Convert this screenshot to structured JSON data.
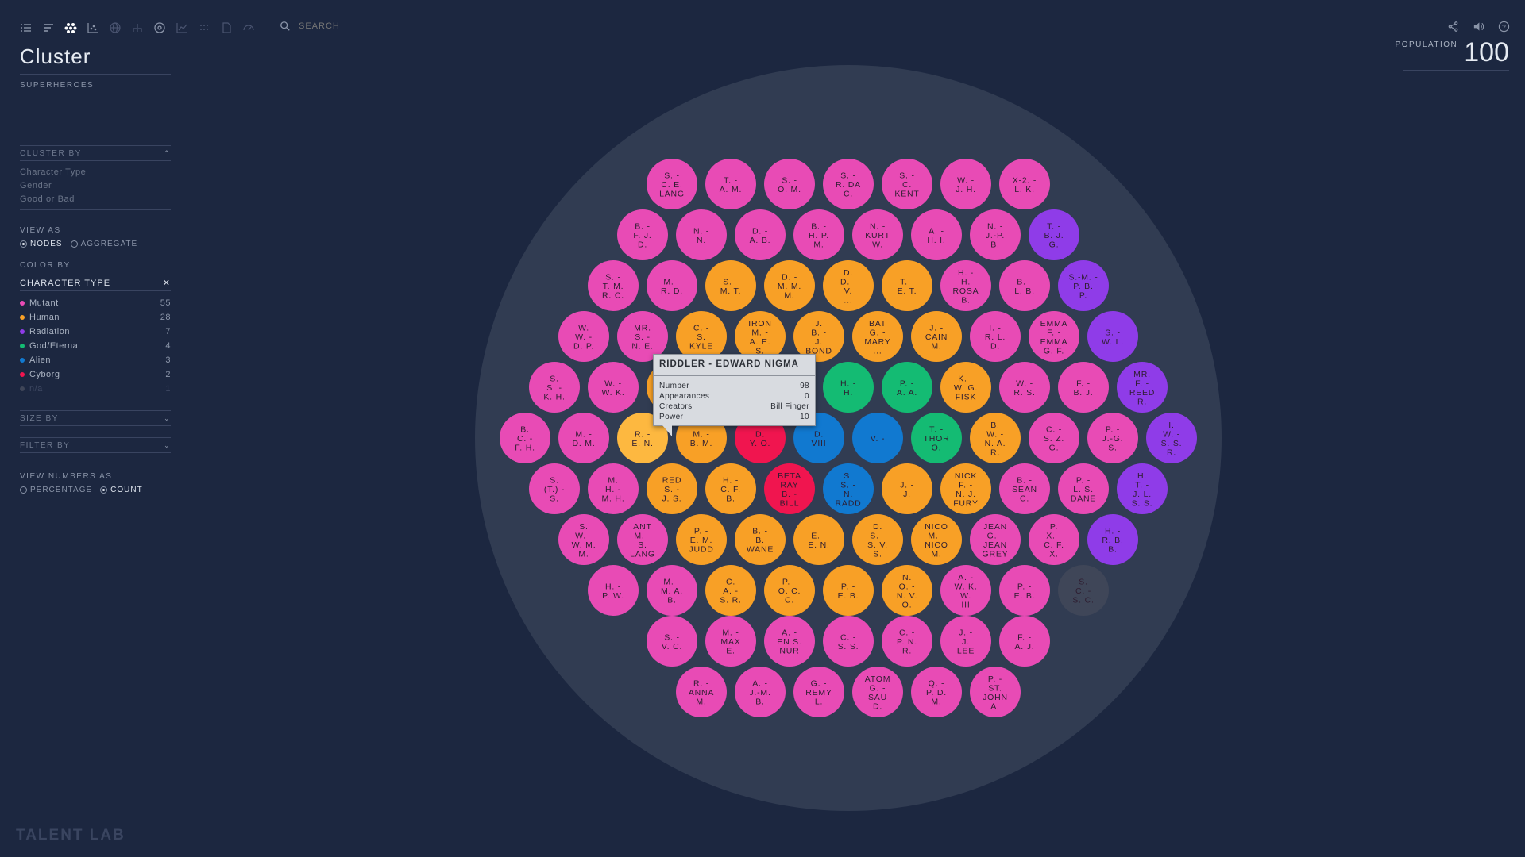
{
  "toolbar": {
    "left_icons": [
      "list-icon",
      "bars-icon",
      "cluster-icon",
      "scatter-icon",
      "globe-icon",
      "tree-icon",
      "target-icon",
      "line-chart-icon",
      "dots-grid-icon",
      "document-icon",
      "gauge-icon"
    ],
    "right_icons": [
      "share-icon",
      "volume-icon",
      "help-icon"
    ]
  },
  "search": {
    "placeholder": "SEARCH"
  },
  "title": "Cluster",
  "subtitle": "SUPERHEROES",
  "cluster_by": {
    "label": "CLUSTER BY",
    "options": [
      "Character Type",
      "Gender",
      "Good or Bad"
    ]
  },
  "view_as": {
    "label": "VIEW AS",
    "options": [
      "NODES",
      "AGGREGATE"
    ],
    "selected": "NODES"
  },
  "color_by": {
    "label": "COLOR BY",
    "selected": "CHARACTER TYPE"
  },
  "legend": [
    {
      "label": "Mutant",
      "count": "55",
      "color": "#e84bb5"
    },
    {
      "label": "Human",
      "count": "28",
      "color": "#f8a026"
    },
    {
      "label": "Radiation",
      "count": "7",
      "color": "#8f3ce8"
    },
    {
      "label": "God/Eternal",
      "count": "4",
      "color": "#14bb73"
    },
    {
      "label": "Alien",
      "count": "3",
      "color": "#1179d0"
    },
    {
      "label": "Cyborg",
      "count": "2",
      "color": "#f0154f"
    },
    {
      "label": "n/a",
      "count": "1",
      "color": "#3f4658"
    }
  ],
  "size_by": {
    "label": "SIZE BY"
  },
  "filter_by": {
    "label": "FILTER BY"
  },
  "view_numbers": {
    "label": "VIEW NUMBERS AS",
    "options": [
      "PERCENTAGE",
      "COUNT"
    ],
    "selected": "COUNT"
  },
  "logo": "TALENT LAB",
  "population": {
    "label": "POPULATION",
    "value": "100"
  },
  "colors": {
    "background": "#1c2740",
    "cluster_bg": "#313c52",
    "mutant": "#e84bb5",
    "human": "#f8a026",
    "radiation": "#8f3ce8",
    "god": "#14bb73",
    "alien": "#1179d0",
    "cyborg": "#f0154f",
    "na": "#3f4658",
    "highlight": "#fdb840"
  },
  "tooltip": {
    "title": "RIDDLER - EDWARD NIGMA",
    "rows": [
      {
        "label": "Number",
        "value": "98"
      },
      {
        "label": "Appearances",
        "value": "0"
      },
      {
        "label": "Creators",
        "value": "Bill Finger"
      },
      {
        "label": "Power",
        "value": "10"
      }
    ]
  },
  "chart_data": {
    "type": "scatter",
    "title": "",
    "layout": "packed hexagonal cluster",
    "rows": [
      [
        [
          "S. -|C. E.|LANG",
          "mutant"
        ],
        [
          "T. -|A. M.",
          "mutant"
        ],
        [
          "S. -|O. M.",
          "mutant"
        ],
        [
          "S. -|R. DA|C.",
          "mutant"
        ],
        [
          "S. -|C.|KENT",
          "mutant"
        ],
        [
          "W. -|J. H.",
          "mutant"
        ],
        [
          "X-2. -|L. K.",
          "mutant"
        ]
      ],
      [
        [
          "B. -|F. J.|D.",
          "mutant"
        ],
        [
          "N. -|N.",
          "mutant"
        ],
        [
          "D. -|A. B.",
          "mutant"
        ],
        [
          "B. -|H. P.|M.",
          "mutant"
        ],
        [
          "N. -|KURT|W.",
          "mutant"
        ],
        [
          "A. -|H. I.",
          "mutant"
        ],
        [
          "N. -|J.-P.|B.",
          "mutant"
        ],
        [
          "T. -|B. J.|G.",
          "radiation"
        ]
      ],
      [
        [
          "S. -|T. M.|R. C.",
          "mutant"
        ],
        [
          "M. -|R. D.",
          "mutant"
        ],
        [
          "S. -|M. T.",
          "human"
        ],
        [
          "D. -|M. M.|M.",
          "human"
        ],
        [
          "D.|D. -|V.|...",
          "human"
        ],
        [
          "T. -|E. T.",
          "human"
        ],
        [
          "H. -|H.|ROSA|B.",
          "mutant"
        ],
        [
          "B. -|L. B.",
          "mutant"
        ],
        [
          "S.-M. -|P. B.|P.",
          "radiation"
        ]
      ],
      [
        [
          "W.|W. -|D. P.",
          "mutant"
        ],
        [
          "MR.|S. -|N. E.",
          "mutant"
        ],
        [
          "C. -|S.|KYLE",
          "human"
        ],
        [
          "IRON|M. -|A. E.|S.",
          "human"
        ],
        [
          "J.|B. -|J.|BOND",
          "human"
        ],
        [
          "BAT|G. -|MARY|...",
          "human"
        ],
        [
          "J. -|CAIN|M.",
          "human"
        ],
        [
          "I. -|R. L.|D.",
          "mutant"
        ],
        [
          "EMMA|F. -|EMMA|G. F.",
          "mutant"
        ],
        [
          "S. -|W. L.",
          "radiation"
        ]
      ],
      [
        [
          "S.|S. -|K. H.",
          "mutant"
        ],
        [
          "W. -|W. K.",
          "mutant"
        ],
        [
          "",
          "human"
        ],
        [
          "",
          "human"
        ],
        [
          "",
          "human"
        ],
        [
          "H. -|H.",
          "god"
        ],
        [
          "P. -|A. A.",
          "god"
        ],
        [
          "K. -|W. G.|FISK",
          "human"
        ],
        [
          "W. -|R. S.",
          "mutant"
        ],
        [
          "F. -|B. J.",
          "mutant"
        ],
        [
          "MR.|F. -|REED|R.",
          "radiation"
        ]
      ],
      [
        [
          "B.|C. -|F. H.",
          "mutant"
        ],
        [
          "M. -|D. M.",
          "mutant"
        ],
        [
          "R. -|E. N.",
          "highlight"
        ],
        [
          "M. -|B. M.",
          "human"
        ],
        [
          "D.|Y. O.",
          "cyborg"
        ],
        [
          "D.|VIII",
          "alien"
        ],
        [
          "V. -",
          "alien"
        ],
        [
          "T. -|THOR|O.",
          "god"
        ],
        [
          "B.|W. -|N. A.|R.",
          "human"
        ],
        [
          "C. -|S. Z.|G.",
          "mutant"
        ],
        [
          "P. -|J.-G.|S.",
          "mutant"
        ],
        [
          "I.|W. -|S. S.|R.",
          "radiation"
        ]
      ],
      [
        [
          "S.|(T.) -|S.",
          "mutant"
        ],
        [
          "M.|H. -|M. H.",
          "mutant"
        ],
        [
          "RED|S. -|J. S.",
          "human"
        ],
        [
          "H. -|C. F.|B.",
          "human"
        ],
        [
          "BETA|RAY|B. -|BILL",
          "cyborg"
        ],
        [
          "S.|S. -|N.|RADD",
          "alien"
        ],
        [
          "J. -|J.",
          "human"
        ],
        [
          "NICK|F. -|N. J.|FURY",
          "human"
        ],
        [
          "B. -|SEAN|C.",
          "mutant"
        ],
        [
          "P. -|L. S.|DANE",
          "mutant"
        ],
        [
          "H.|T. -|J. L.|S. S.",
          "radiation"
        ]
      ],
      [
        [
          "S.|W. -|W. M.|M.",
          "mutant"
        ],
        [
          "ANT|M. -|S.|LANG",
          "mutant"
        ],
        [
          "P. -|E. M.|JUDD",
          "human"
        ],
        [
          "B. -|B.|WANE",
          "human"
        ],
        [
          "E. -|E. N.",
          "human"
        ],
        [
          "D.|S. -|S. V.|S.",
          "human"
        ],
        [
          "NICO|M. -|NICO|M.",
          "human"
        ],
        [
          "JEAN|G. -|JEAN|GREY",
          "mutant"
        ],
        [
          "P.|X. -|C. F.|X.",
          "mutant"
        ],
        [
          "H. -|R. B.|B.",
          "radiation"
        ]
      ],
      [
        [
          "H. -|P. W.",
          "mutant"
        ],
        [
          "M. -|M. A.|B.",
          "mutant"
        ],
        [
          "C.|A. -|S. R.",
          "human"
        ],
        [
          "P. -|O. C.|C.",
          "human"
        ],
        [
          "P. -|E. B.",
          "human"
        ],
        [
          "N.|O. -|N. V.|O.",
          "human"
        ],
        [
          "A. -|W. K.|W.|III",
          "mutant"
        ],
        [
          "P. -|E. B.",
          "mutant"
        ],
        [
          "S.|C. -|S. C.",
          "na"
        ]
      ],
      [
        [
          "S. -|V. C.",
          "mutant"
        ],
        [
          "M. -|MAX|E.",
          "mutant"
        ],
        [
          "A. -|EN S.|NUR",
          "mutant"
        ],
        [
          "C. -|S. S.",
          "mutant"
        ],
        [
          "C. -|P. N.|R.",
          "mutant"
        ],
        [
          "J. -|J.|LEE",
          "mutant"
        ],
        [
          "F. -|A. J.",
          "mutant"
        ]
      ],
      [
        [
          "R. -|ANNA|M.",
          "mutant"
        ],
        [
          "A. -|J.-M.|B.",
          "mutant"
        ],
        [
          "G. -|REMY|L.",
          "mutant"
        ],
        [
          "ATOM|G. -|SAU|D.",
          "mutant"
        ],
        [
          "Q. -|P. D.|M.",
          "mutant"
        ],
        [
          "P. -|ST.|JOHN|A.",
          "mutant"
        ]
      ]
    ]
  }
}
